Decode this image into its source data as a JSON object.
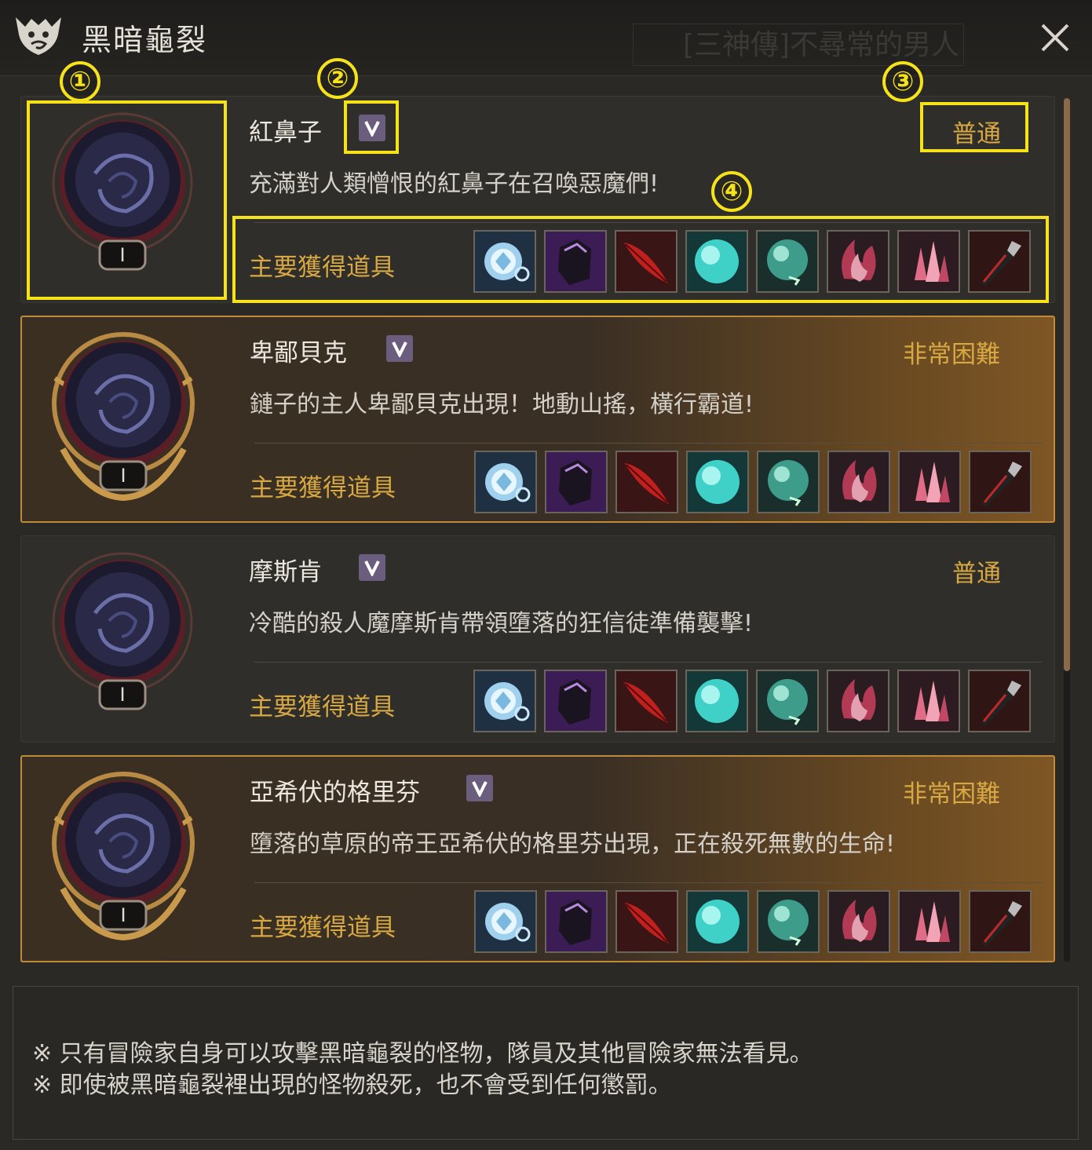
{
  "window": {
    "title": "黑暗龜裂",
    "background_text": "[三神傳]不尋常的男人"
  },
  "annotations": [
    "①",
    "②",
    "③",
    "④"
  ],
  "rift_list": [
    {
      "name": "紅鼻子",
      "difficulty": "普通",
      "description": "充滿對人類憎恨的紅鼻子在召喚惡魔們!",
      "rewards_label": "主要獲得道具",
      "tier": "I"
    },
    {
      "name": "卑鄙貝克",
      "difficulty": "非常困難",
      "description": "鏈子的主人卑鄙貝克出現！地動山搖，橫行霸道!",
      "rewards_label": "主要獲得道具",
      "tier": "I"
    },
    {
      "name": "摩斯肯",
      "difficulty": "普通",
      "description": "冷酷的殺人魔摩斯肯帶領墮落的狂信徒準備襲擊!",
      "rewards_label": "主要獲得道具",
      "tier": "I"
    },
    {
      "name": "亞希伏的格里芬",
      "difficulty": "非常困難",
      "description": "墮落的草原的帝王亞希伏的格里芬出現，正在殺死無數的生命!",
      "rewards_label": "主要獲得道具",
      "tier": "I"
    }
  ],
  "reward_icons": [
    "crystal-ring-icon",
    "dark-armor-icon",
    "red-feather-icon",
    "teal-orb-icon",
    "jade-orb-icon",
    "crimson-flame-icon",
    "pink-crystal-icon",
    "dagger-icon"
  ],
  "notes": [
    "※ 只有冒險家自身可以攻擊黑暗龜裂的怪物，隊員及其他冒險家無法看見。",
    "※ 即使被黑暗龜裂裡出現的怪物殺死，也不會受到任何懲罰。"
  ],
  "colors": {
    "accent_gold": "#d8a843",
    "annotation_yellow": "#f5e21a",
    "hard_border": "#c08a3c",
    "chevron_purple": "#6a5d7d"
  }
}
